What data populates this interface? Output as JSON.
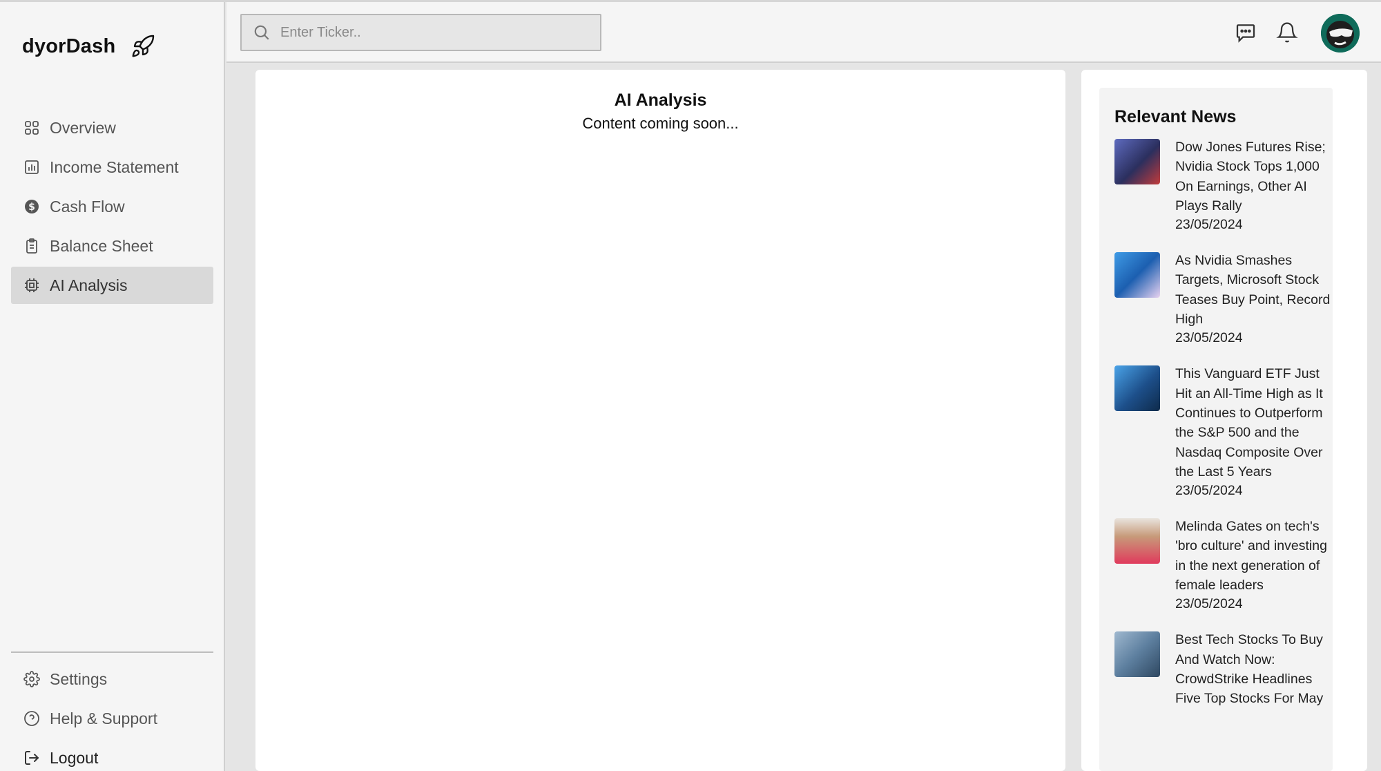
{
  "brand": {
    "name": "dyorDash",
    "icon": "rocket-icon"
  },
  "sidebar": {
    "items": [
      {
        "label": "Overview",
        "icon": "grid-icon",
        "active": false
      },
      {
        "label": "Income Statement",
        "icon": "bar-chart-icon",
        "active": false
      },
      {
        "label": "Cash Flow",
        "icon": "dollar-circle-icon",
        "active": false
      },
      {
        "label": "Balance Sheet",
        "icon": "clipboard-icon",
        "active": false
      },
      {
        "label": "AI Analysis",
        "icon": "cpu-icon",
        "active": true
      }
    ],
    "bottom_items": [
      {
        "label": "Settings",
        "icon": "gear-icon"
      },
      {
        "label": "Help & Support",
        "icon": "help-circle-icon"
      },
      {
        "label": "Logout",
        "icon": "logout-icon"
      }
    ]
  },
  "header": {
    "search_placeholder": "Enter Ticker..",
    "icons": [
      "message-icon",
      "bell-icon",
      "avatar"
    ]
  },
  "main": {
    "title": "AI Analysis",
    "subtitle": "Content coming soon..."
  },
  "news": {
    "heading": "Relevant News",
    "items": [
      {
        "title": "Dow Jones Futures Rise; Nvidia Stock Tops 1,000 On Earnings, Other AI Plays Rally",
        "date": "23/05/2024",
        "thumb_color": "#3a3f7a"
      },
      {
        "title": "As Nvidia Smashes Targets, Microsoft Stock Teases Buy Point, Record High",
        "date": "23/05/2024",
        "thumb_color": "#2e7fd0"
      },
      {
        "title": "This Vanguard ETF Just Hit an All-Time High as It Continues to Outperform the S&P 500 and the Nasdaq Composite Over the Last 5 Years",
        "date": "23/05/2024",
        "thumb_color": "#2a5f9e"
      },
      {
        "title": "Melinda Gates on tech's 'bro culture' and investing in the next generation of female leaders",
        "date": "23/05/2024",
        "thumb_color": "#d9435e"
      },
      {
        "title": "Best Tech Stocks To Buy And Watch Now: CrowdStrike Headlines Five Top Stocks For May",
        "date": "",
        "thumb_color": "#6e8fb0"
      }
    ]
  },
  "colors": {
    "accent": "#d9d9d9",
    "background": "#e5e5e5",
    "panel": "#ffffff"
  }
}
